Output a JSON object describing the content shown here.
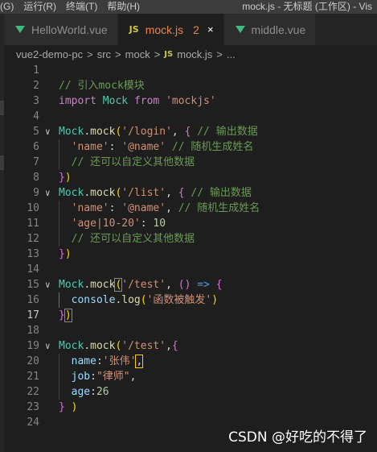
{
  "titlebar": {
    "menu": [
      "(G)",
      "运行(R)",
      "终端(T)",
      "帮助(H)"
    ],
    "window_title": "mock.js - 无标题 (工作区) - Vis"
  },
  "tabs": [
    {
      "label": "HelloWorld.vue",
      "icon": "vue-icon"
    },
    {
      "label": "mock.js",
      "icon": "js-icon",
      "badge": "2",
      "close": "×"
    },
    {
      "label": "middle.vue",
      "icon": "vue-icon"
    }
  ],
  "icon_text": {
    "js": "JS"
  },
  "breadcrumb": [
    "vue2-demo-pc",
    "src",
    "mock",
    "mock.js",
    "..."
  ],
  "editor": {
    "current_line": 17,
    "lines": [
      {
        "n": "1",
        "t": []
      },
      {
        "n": "2",
        "t": [
          [
            "cm",
            "// 引入mock模块"
          ]
        ]
      },
      {
        "n": "3",
        "t": [
          [
            "kw",
            "import"
          ],
          [
            "pn",
            " "
          ],
          [
            "id",
            "Mock"
          ],
          [
            "pn",
            " "
          ],
          [
            "kw",
            "from"
          ],
          [
            "pn",
            " "
          ],
          [
            "str",
            "'mockjs'"
          ]
        ]
      },
      {
        "n": "4",
        "t": []
      },
      {
        "n": "5",
        "t": [
          [
            "id",
            "Mock"
          ],
          [
            "pn",
            "."
          ],
          [
            "fn",
            "mock"
          ],
          [
            "b1",
            "("
          ],
          [
            "str",
            "'/login'"
          ],
          [
            "pn",
            ", "
          ],
          [
            "b2",
            "{"
          ],
          [
            "pn",
            " "
          ],
          [
            "cm",
            "// 输出数据"
          ]
        ]
      },
      {
        "n": "6",
        "t": [
          [
            "pn",
            "  "
          ],
          [
            "str",
            "'name'"
          ],
          [
            "pn",
            ": "
          ],
          [
            "str",
            "'@name'"
          ],
          [
            "pn",
            " "
          ],
          [
            "cm",
            "// 随机生成姓名"
          ]
        ]
      },
      {
        "n": "7",
        "t": [
          [
            "pn",
            "  "
          ],
          [
            "cm",
            "// 还可以自定义其他数据"
          ]
        ]
      },
      {
        "n": "8",
        "t": [
          [
            "b2",
            "}"
          ],
          [
            "b1",
            ")"
          ]
        ]
      },
      {
        "n": "9",
        "t": [
          [
            "id",
            "Mock"
          ],
          [
            "pn",
            "."
          ],
          [
            "fn",
            "mock"
          ],
          [
            "b1",
            "("
          ],
          [
            "str",
            "'/list'"
          ],
          [
            "pn",
            ", "
          ],
          [
            "b2",
            "{"
          ],
          [
            "pn",
            " "
          ],
          [
            "cm",
            "// 输出数据"
          ]
        ]
      },
      {
        "n": "10",
        "t": [
          [
            "pn",
            "  "
          ],
          [
            "str",
            "'name'"
          ],
          [
            "pn",
            ": "
          ],
          [
            "str",
            "'@name'"
          ],
          [
            "pn",
            ", "
          ],
          [
            "cm",
            "// 随机生成姓名"
          ]
        ]
      },
      {
        "n": "11",
        "t": [
          [
            "pn",
            "  "
          ],
          [
            "str",
            "'age|10-20'"
          ],
          [
            "pn",
            ": "
          ],
          [
            "num",
            "10"
          ]
        ]
      },
      {
        "n": "12",
        "t": [
          [
            "pn",
            "  "
          ],
          [
            "cm",
            "// 还可以自定义其他数据"
          ]
        ]
      },
      {
        "n": "13",
        "t": [
          [
            "b2",
            "}"
          ],
          [
            "b1",
            ")"
          ]
        ]
      },
      {
        "n": "14",
        "t": []
      },
      {
        "n": "15",
        "t": [
          [
            "id",
            "Mock"
          ],
          [
            "pn",
            "."
          ],
          [
            "fn",
            "mock"
          ],
          [
            "b1",
            "(",
            "hl-br"
          ],
          [
            "str",
            "'/test'"
          ],
          [
            "pn",
            ", "
          ],
          [
            "b2",
            "("
          ],
          [
            "b2",
            ")"
          ],
          [
            "pn",
            " "
          ],
          [
            "ar",
            "=>"
          ],
          [
            "pn",
            " "
          ],
          [
            "b2",
            "{"
          ]
        ]
      },
      {
        "n": "16",
        "t": [
          [
            "pn",
            "  "
          ],
          [
            "var",
            "console"
          ],
          [
            "pn",
            "."
          ],
          [
            "fn",
            "log"
          ],
          [
            "b1",
            "("
          ],
          [
            "str",
            "'函数被触发'"
          ],
          [
            "b1",
            ")"
          ]
        ]
      },
      {
        "n": "17",
        "t": [
          [
            "b2",
            "}"
          ],
          [
            "b1",
            ")",
            "hl-br"
          ]
        ]
      },
      {
        "n": "18",
        "t": []
      },
      {
        "n": "19",
        "t": [
          [
            "id",
            "Mock"
          ],
          [
            "pn",
            "."
          ],
          [
            "fn",
            "mock"
          ],
          [
            "b1",
            "("
          ],
          [
            "str",
            "'/test'"
          ],
          [
            "pn",
            ","
          ],
          [
            "b2",
            "{"
          ]
        ]
      },
      {
        "n": "20",
        "t": [
          [
            "pn",
            "  "
          ],
          [
            "var",
            "name"
          ],
          [
            "pn",
            ":"
          ],
          [
            "str",
            "'张伟'"
          ],
          [
            "pn",
            ",",
            "hl-warn"
          ]
        ]
      },
      {
        "n": "21",
        "t": [
          [
            "pn",
            "  "
          ],
          [
            "var",
            "job"
          ],
          [
            "pn",
            ":"
          ],
          [
            "str",
            "\"律师\""
          ],
          [
            "pn",
            ","
          ]
        ]
      },
      {
        "n": "22",
        "t": [
          [
            "pn",
            "  "
          ],
          [
            "var",
            "age"
          ],
          [
            "pn",
            ":"
          ],
          [
            "num",
            "26"
          ]
        ]
      },
      {
        "n": "23",
        "t": [
          [
            "b2",
            "}"
          ],
          [
            "pn",
            " "
          ],
          [
            "b1",
            ")"
          ]
        ]
      },
      {
        "n": "24",
        "t": []
      }
    ]
  },
  "watermark": "CSDN @好吃的不得了"
}
